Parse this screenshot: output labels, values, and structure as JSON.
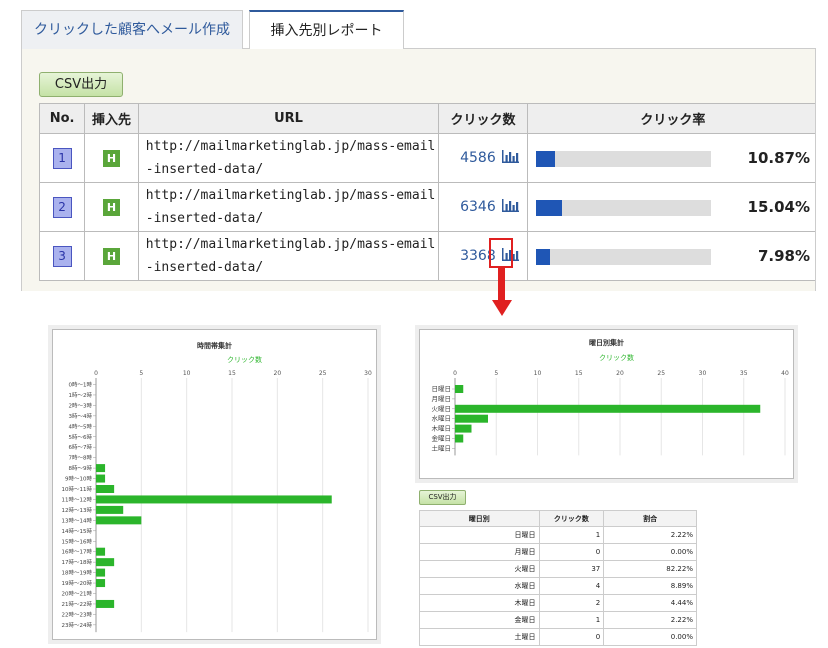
{
  "tabs": [
    {
      "label": "クリックした顧客へメール作成",
      "active": false
    },
    {
      "label": "挿入先別レポート",
      "active": true
    }
  ],
  "csv_label": "CSV出力",
  "table": {
    "headers": [
      "No.",
      "挿入先",
      "URL",
      "クリック数",
      "クリック率"
    ],
    "rows": [
      {
        "no": "1",
        "type": "H",
        "url": "http://mailmarketinglab.jp/mass-email-inserted-data/",
        "clicks": "4586",
        "rate": 0.1087,
        "rate_label": "10.87%"
      },
      {
        "no": "2",
        "type": "H",
        "url": "http://mailmarketinglab.jp/mass-email-inserted-data/",
        "clicks": "6346",
        "rate": 0.1504,
        "rate_label": "15.04%"
      },
      {
        "no": "3",
        "type": "H",
        "url": "http://mailmarketinglab.jp/mass-email-inserted-data/",
        "clicks": "3368",
        "rate": 0.0798,
        "rate_label": "7.98%"
      }
    ]
  },
  "colors": {
    "accent": "#2f5a9c",
    "bar_fill": "#1f56b5",
    "chart_green": "#2bb52b",
    "highlight": "#e02020",
    "badge_green": "#5aa63a"
  },
  "chart_data": [
    {
      "type": "bar",
      "orientation": "horizontal",
      "title": "時間帯集計",
      "legend": "クリック数",
      "xlim": [
        0,
        30
      ],
      "xticks": [
        "0",
        "5",
        "10",
        "15",
        "20",
        "25",
        "30"
      ],
      "categories": [
        "0時～1時",
        "1時～2時",
        "2時～3時",
        "3時～4時",
        "4時～5時",
        "5時～6時",
        "6時～7時",
        "7時～8時",
        "8時～9時",
        "9時～10時",
        "10時～11時",
        "11時～12時",
        "12時～13時",
        "13時～14時",
        "14時～15時",
        "15時～16時",
        "16時～17時",
        "17時～18時",
        "18時～19時",
        "19時～20時",
        "20時～21時",
        "21時～22時",
        "22時～23時",
        "23時～24時"
      ],
      "values": [
        0,
        0,
        0,
        0,
        0,
        0,
        0,
        0,
        1,
        1,
        2,
        26,
        3,
        5,
        0,
        0,
        1,
        2,
        1,
        1,
        0,
        2,
        0,
        0
      ]
    },
    {
      "type": "bar",
      "orientation": "horizontal",
      "title": "曜日別集計",
      "legend": "クリック数",
      "xlim": [
        0,
        40
      ],
      "xticks": [
        "0",
        "5",
        "10",
        "15",
        "20",
        "25",
        "30",
        "35",
        "40"
      ],
      "categories": [
        "日曜日",
        "月曜日",
        "火曜日",
        "水曜日",
        "木曜日",
        "金曜日",
        "土曜日"
      ],
      "values": [
        1,
        0,
        37,
        4,
        2,
        1,
        0
      ]
    },
    {
      "type": "table",
      "csv_label": "CSV出力",
      "headers": [
        "曜日別",
        "クリック数",
        "割合"
      ],
      "rows": [
        [
          "日曜日",
          "1",
          "2.22%"
        ],
        [
          "月曜日",
          "0",
          "0.00%"
        ],
        [
          "火曜日",
          "37",
          "82.22%"
        ],
        [
          "水曜日",
          "4",
          "8.89%"
        ],
        [
          "木曜日",
          "2",
          "4.44%"
        ],
        [
          "金曜日",
          "1",
          "2.22%"
        ],
        [
          "土曜日",
          "0",
          "0.00%"
        ]
      ]
    }
  ]
}
